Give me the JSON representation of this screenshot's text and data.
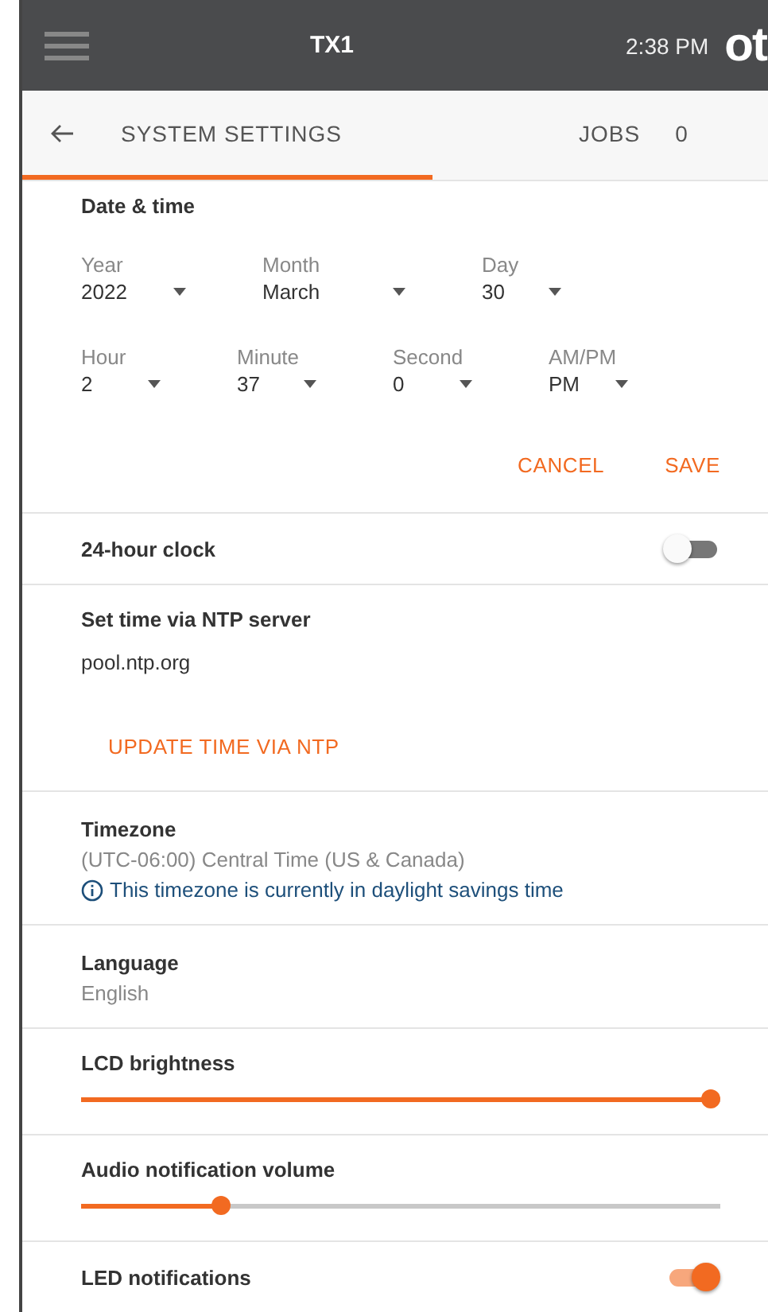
{
  "top_bar": {
    "title": "TX1",
    "time": "2:38 PM",
    "logo": "ot"
  },
  "tabs": [
    {
      "label": "SYSTEM SETTINGS",
      "selected": true
    },
    {
      "label": "JOBS",
      "count": "0",
      "selected": false
    }
  ],
  "date_time": {
    "title": "Date & time",
    "rows": [
      [
        {
          "label": "Year",
          "value": "2022"
        },
        {
          "label": "Month",
          "value": "March"
        },
        {
          "label": "Day",
          "value": "30"
        }
      ],
      [
        {
          "label": "Hour",
          "value": "2"
        },
        {
          "label": "Minute",
          "value": "37"
        },
        {
          "label": "Second",
          "value": "0"
        },
        {
          "label": "AM/PM",
          "value": "PM"
        }
      ]
    ],
    "actions": [
      "CANCEL",
      "SAVE"
    ]
  },
  "settings": [
    {
      "kind": "toggle",
      "label": "24-hour clock",
      "on": false
    },
    {
      "kind": "ntp",
      "label": "Set time via NTP server",
      "value": "pool.ntp.org",
      "action": "UPDATE TIME VIA NTP"
    },
    {
      "kind": "info",
      "label": "Timezone",
      "value": "(UTC-06:00) Central Time (US & Canada)",
      "note": "This timezone is currently in daylight savings time"
    },
    {
      "kind": "info",
      "label": "Language",
      "value": "English"
    },
    {
      "kind": "slider",
      "label": "LCD brightness",
      "level": 1.0
    },
    {
      "kind": "slider",
      "label": "Audio notification volume",
      "level": 0.21
    },
    {
      "kind": "toggle",
      "label": "LED notifications",
      "on": true
    }
  ]
}
